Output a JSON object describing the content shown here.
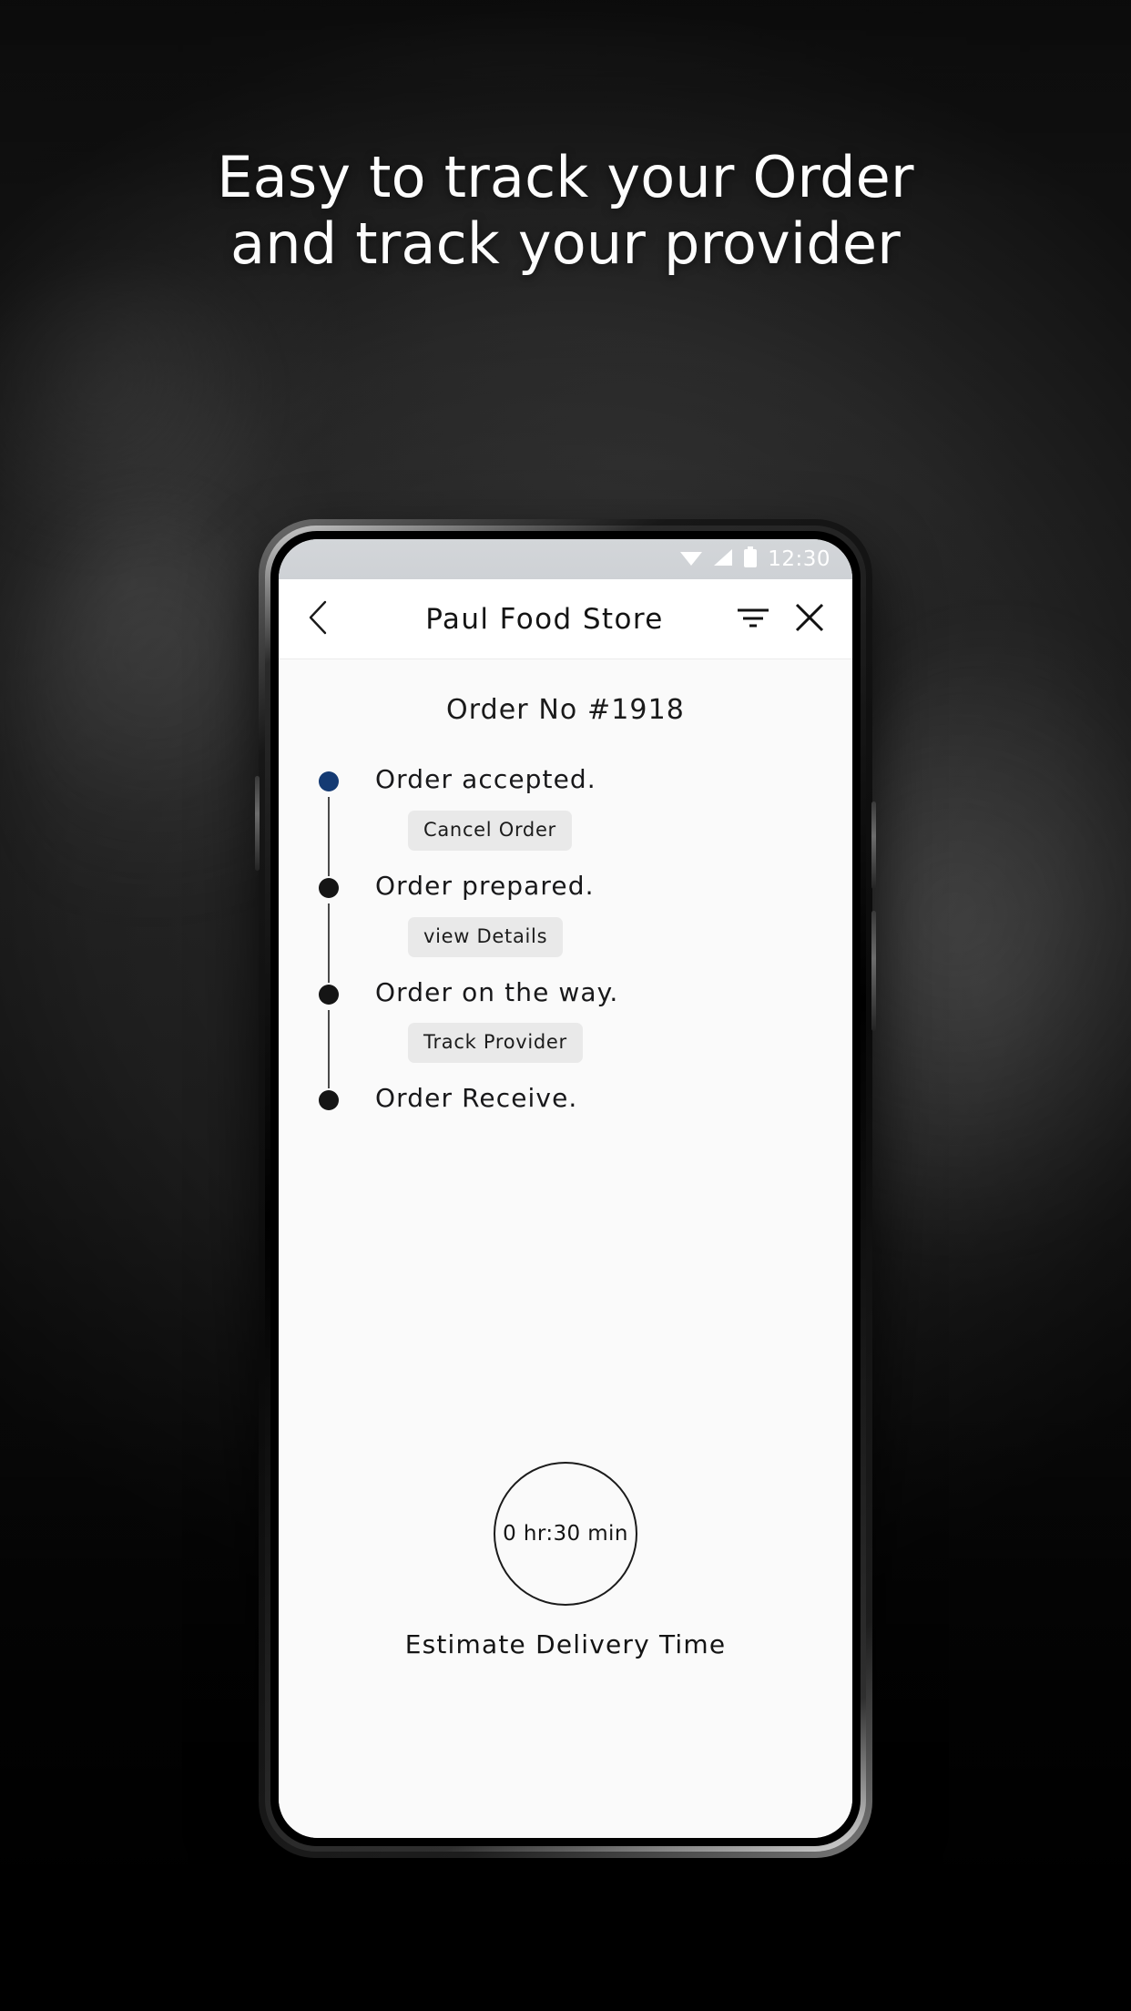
{
  "promo": {
    "headline_line1": "Easy to track your Order",
    "headline_line2": "and track your provider"
  },
  "phone": {
    "statusbar": {
      "wifi_icon": "wifi-icon",
      "signal_icon": "signal-icon",
      "battery_icon": "battery-icon",
      "time": "12:30"
    },
    "appbar": {
      "back_icon": "back-chevron-icon",
      "title": "Paul Food Store",
      "filter_icon": "filter-icon",
      "close_icon": "close-icon"
    },
    "order": {
      "order_no_label": "Order No #1918",
      "timeline": [
        {
          "label": "Order accepted.",
          "dot_color": "#143a73",
          "action": "Cancel Order",
          "has_connector": true
        },
        {
          "label": "Order prepared.",
          "dot_color": "#151515",
          "action": "view Details",
          "has_connector": true
        },
        {
          "label": "Order on the way.",
          "dot_color": "#151515",
          "action": "Track Provider",
          "has_connector": true
        },
        {
          "label": "Order Receive.",
          "dot_color": "#151515",
          "action": null,
          "has_connector": false
        }
      ],
      "estimate": {
        "value": "0 hr:30 min",
        "caption": "Estimate Delivery Time"
      }
    }
  },
  "colors": {
    "accent_blue": "#143a73",
    "dot_dark": "#151515",
    "chip_bg": "#e9e9e9",
    "screen_bg": "#fafafa",
    "statusbar_bg": "#d1d4d8"
  }
}
